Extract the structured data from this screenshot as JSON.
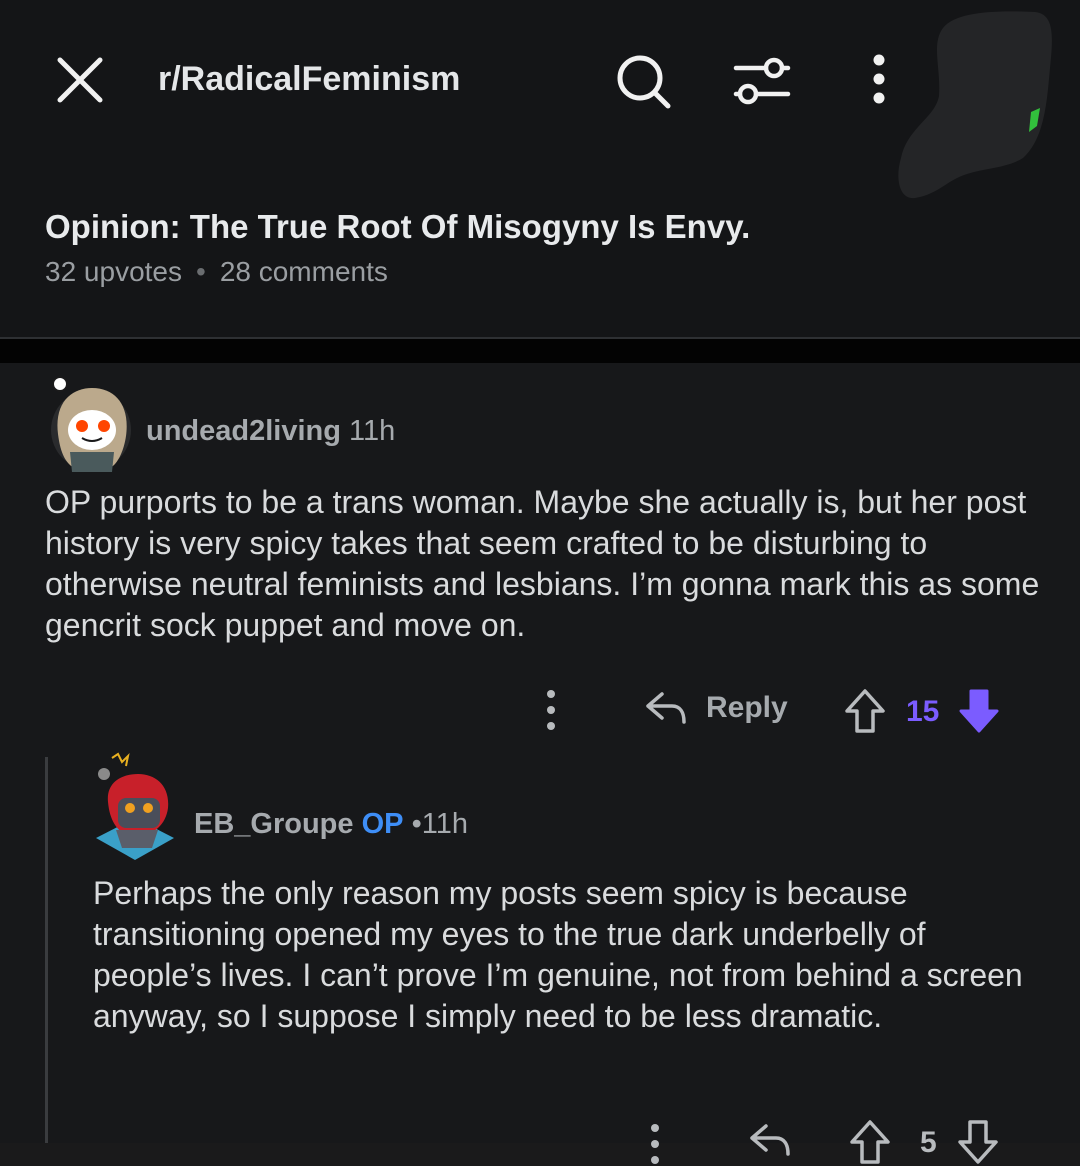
{
  "header": {
    "subreddit": "r/RadicalFeminism"
  },
  "post": {
    "title": "Opinion: The True Root Of Misogyny Is Envy.",
    "upvotes": "32 upvotes",
    "separator": "•",
    "comments": "28 comments"
  },
  "comments": [
    {
      "username": "undead2living",
      "age": "11h",
      "body": "OP purports to be a trans woman. Maybe she actually is, but her post history is very spicy takes that seem crafted to be disturbing to otherwise neutral feminists and lesbians. I’m gonna mark this as some gencrit sock puppet and move on.",
      "reply_label": "Reply",
      "score": "15",
      "vote_state": "downvoted",
      "accent": "#7b5cff"
    },
    {
      "username": "EB_Groupe",
      "op_badge": "OP",
      "age_sep": "•",
      "age": "11h",
      "body": "Perhaps the only reason my posts seem spicy is because transitioning opened my eyes to the true dark underbelly of people’s lives. I can’t prove I’m genuine, not from behind a screen anyway, so I suppose I simply need to be less dramatic.",
      "score": "5"
    }
  ],
  "icons": [
    "close-icon",
    "search-icon",
    "filter-icon",
    "more-vertical-icon",
    "reply-arrow-icon",
    "upvote-arrow-icon",
    "downvote-arrow-icon"
  ],
  "colors": {
    "background": "#17181a",
    "header_bg": "#141517",
    "op_badge": "#3e8ef7",
    "vote_accent": "#7b5cff"
  }
}
